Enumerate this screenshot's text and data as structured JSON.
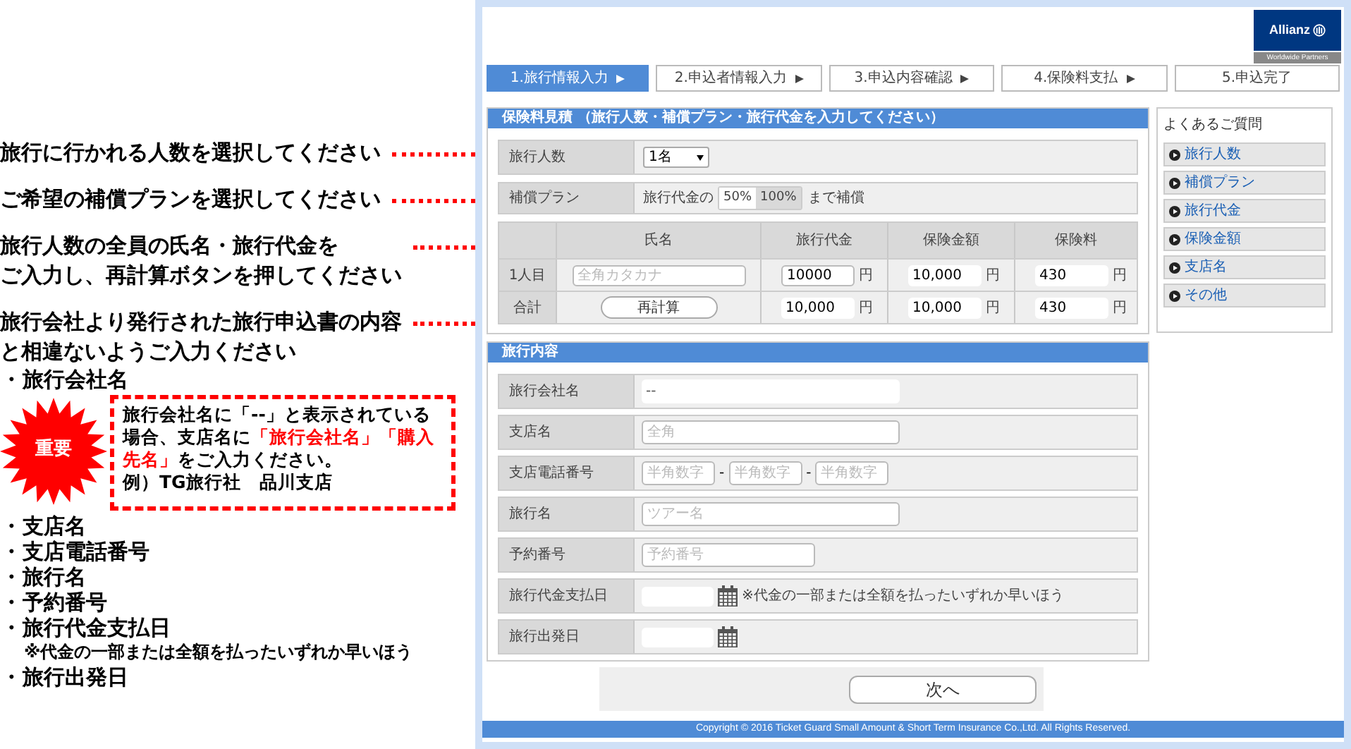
{
  "guide": [
    {
      "kind": "instruction",
      "lines": [
        "旅行に行かれる人数を選択してください"
      ]
    },
    {
      "kind": "instruction",
      "lines": [
        "ご希望の補償プランを選択してください"
      ]
    },
    {
      "kind": "instruction",
      "lines": [
        "旅行人数の全員の氏名・旅行代金を",
        "ご入力し、再計算ボタンを押してください"
      ]
    },
    {
      "kind": "instruction",
      "lines": [
        "旅行会社より発行された旅行申込書の内容",
        "と相違ないようご入力ください"
      ]
    },
    {
      "kind": "bullet",
      "mark": "・",
      "text": "旅行会社名"
    },
    {
      "kind": "notice",
      "badge": "重要",
      "segments": [
        {
          "text": "旅行会社名に「--」と表示されている場合、支店名に",
          "highlight": false
        },
        {
          "text": "「旅行会社名」「購入先名」",
          "highlight": true
        },
        {
          "text": "をご入力ください。",
          "highlight": false
        }
      ],
      "example": "例）TG旅行社　品川支店"
    },
    {
      "kind": "bullet",
      "mark": "・",
      "text": "支店名"
    },
    {
      "kind": "bullet",
      "mark": "・",
      "text": "支店電話番号"
    },
    {
      "kind": "bullet",
      "mark": "・",
      "text": "旅行名"
    },
    {
      "kind": "bullet",
      "mark": "・",
      "text": "予約番号"
    },
    {
      "kind": "bullet",
      "mark": "・",
      "text": "旅行代金支払日"
    },
    {
      "kind": "note",
      "text": "※代金の一部または全額を払ったいずれか早いほう"
    },
    {
      "kind": "bullet",
      "mark": "・",
      "text": "旅行出発日"
    }
  ],
  "logo": {
    "name": "Allianz",
    "tagline": "Worldwide Partners"
  },
  "steps": [
    {
      "label": "1.旅行情報入力",
      "selected": true,
      "arrow": true
    },
    {
      "label": "2.申込者情報入力",
      "selected": false,
      "arrow": true
    },
    {
      "label": "3.申込内容確認",
      "selected": false,
      "arrow": true
    },
    {
      "label": "4.保険料支払",
      "selected": false,
      "arrow": true
    },
    {
      "label": "5.申込完了",
      "selected": false,
      "arrow": false
    }
  ],
  "estimate": {
    "title": "保険料見積 （旅行人数・補償プラン・旅行代金を入力してください）",
    "travelers": {
      "label": "旅行人数",
      "value": "1名"
    },
    "plan": {
      "label": "補償プラン",
      "prefix": "旅行代金の",
      "options": [
        {
          "label": "50%",
          "selected": false
        },
        {
          "label": "100%",
          "selected": true
        }
      ],
      "suffix": "まで補償"
    },
    "table": {
      "columns": [
        "氏名",
        "旅行代金",
        "保険金額",
        "保険料"
      ],
      "rows": [
        {
          "label": "1人目",
          "cells": [
            {
              "kind": "text_input",
              "placeholder": "全角カタカナ"
            },
            {
              "kind": "yen",
              "value": "10000",
              "unit": "円",
              "editable": true
            },
            {
              "kind": "yen",
              "value": "10,000",
              "unit": "円",
              "editable": false
            },
            {
              "kind": "yen",
              "value": "430",
              "unit": "円",
              "editable": false
            }
          ]
        },
        {
          "label": "合計",
          "cells": [
            {
              "kind": "button",
              "label": "再計算"
            },
            {
              "kind": "yen",
              "value": "10,000",
              "unit": "円",
              "editable": false
            },
            {
              "kind": "yen",
              "value": "10,000",
              "unit": "円",
              "editable": false
            },
            {
              "kind": "yen",
              "value": "430",
              "unit": "円",
              "editable": false
            }
          ]
        }
      ]
    }
  },
  "faq": {
    "title": "よくあるご質問",
    "items": [
      "旅行人数",
      "補償プラン",
      "旅行代金",
      "保険金額",
      "支店名",
      "その他"
    ]
  },
  "travel": {
    "title": "旅行内容",
    "rows": [
      {
        "label": "旅行会社名",
        "kind": "readonly",
        "value": "--"
      },
      {
        "label": "支店名",
        "kind": "text",
        "placeholder": "全角"
      },
      {
        "label": "支店電話番号",
        "kind": "phone",
        "placeholders": [
          "半角数字",
          "半角数字",
          "半角数字"
        ],
        "separator": "-"
      },
      {
        "label": "旅行名",
        "kind": "text",
        "placeholder": "ツアー名"
      },
      {
        "label": "予約番号",
        "kind": "short_text",
        "placeholder": "予約番号"
      },
      {
        "label": "旅行代金支払日",
        "kind": "date",
        "note": "※代金の一部または全額を払ったいずれか早いほう"
      },
      {
        "label": "旅行出発日",
        "kind": "date"
      }
    ]
  },
  "next_button": "次へ",
  "footer": "Copyright © 2016 Ticket Guard Small Amount & Short Term Insurance Co.,Ltd. All Rights Reserved."
}
